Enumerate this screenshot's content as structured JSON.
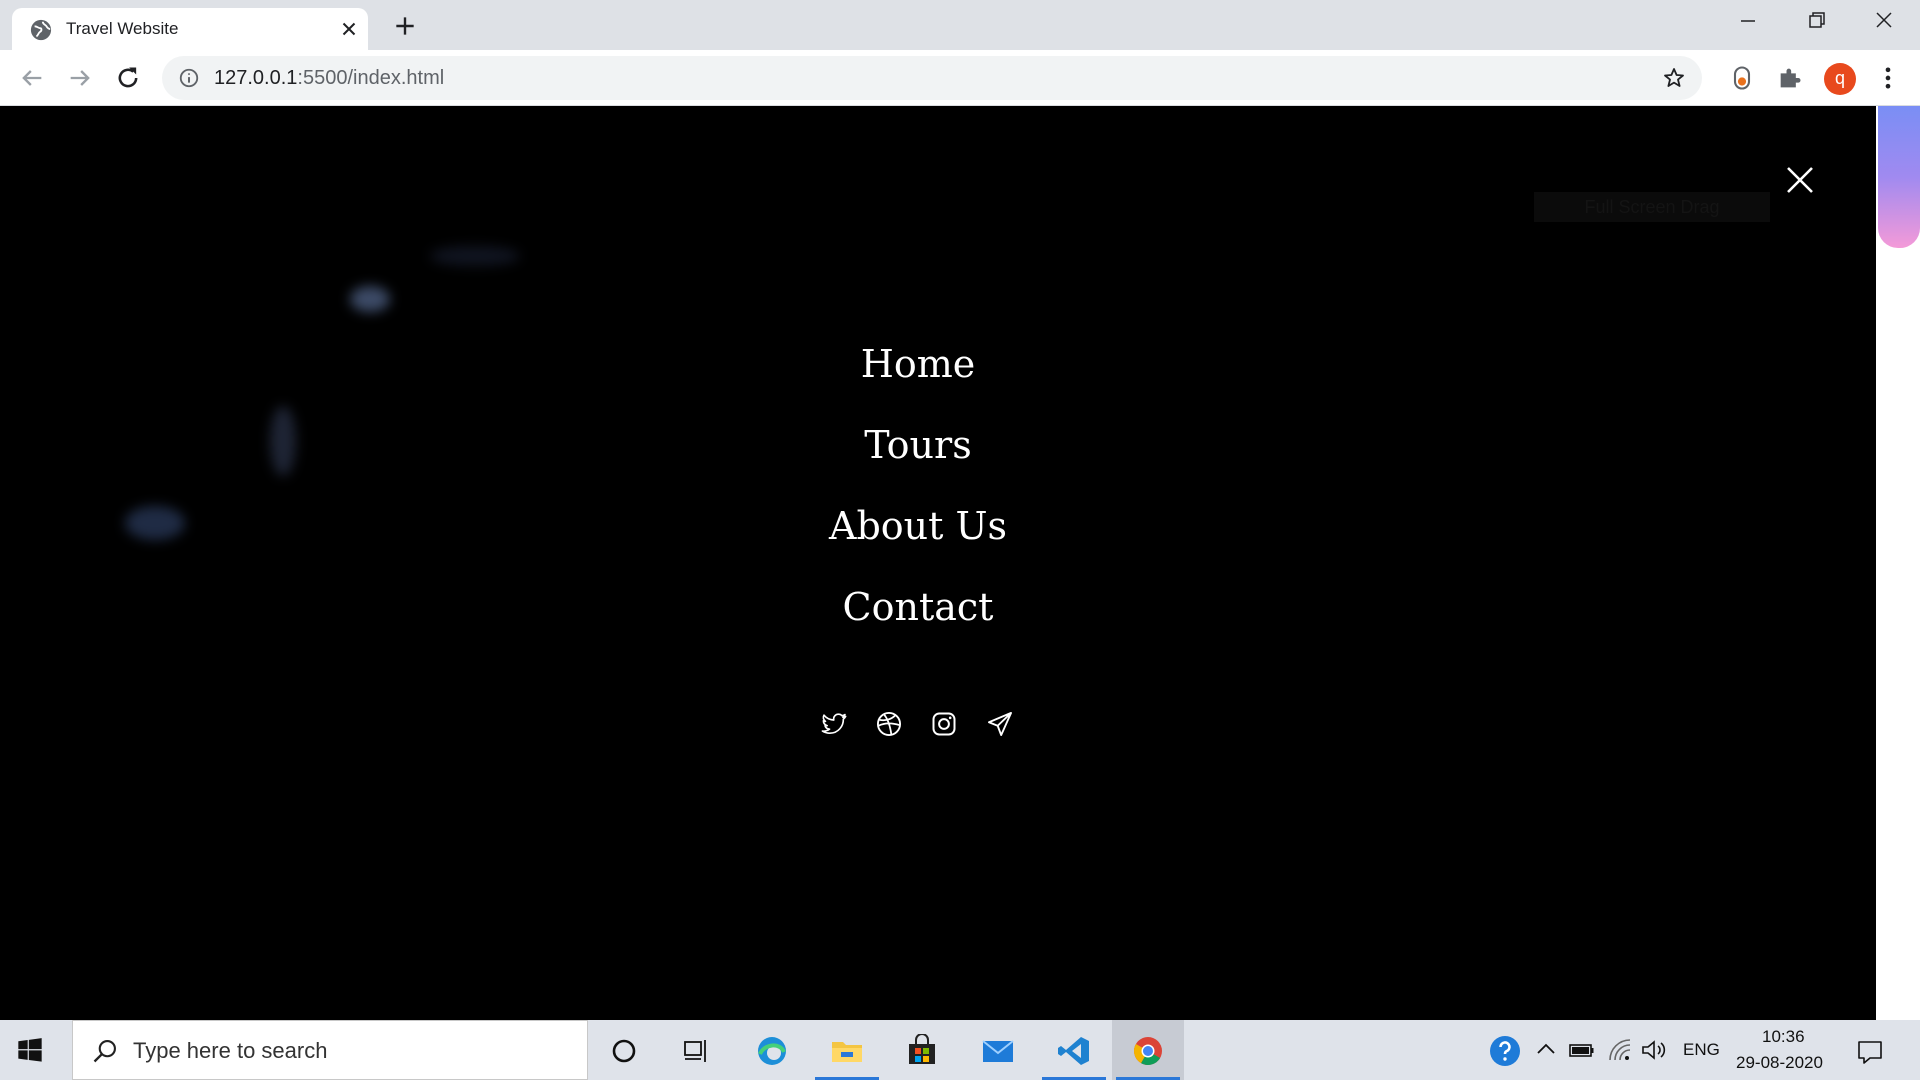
{
  "browser": {
    "tab_title": "Travel Website",
    "url_host": "127.0.0.1",
    "url_rest": ":5500/index.html",
    "avatar_letter": "q"
  },
  "page": {
    "ghost_button_label": "Full Screen Drag",
    "menu": [
      {
        "label": "Home"
      },
      {
        "label": "Tours"
      },
      {
        "label": "About Us"
      },
      {
        "label": "Contact"
      }
    ],
    "socials": [
      "twitter-icon",
      "dribbble-icon",
      "instagram-icon",
      "telegram-icon"
    ],
    "scrollbar_colors": [
      "#7a8ef5",
      "#f49ad8"
    ]
  },
  "taskbar": {
    "search_placeholder": "Type here to search",
    "apps": [
      "cortana-icon",
      "task-view-icon",
      "edge-icon",
      "file-explorer-icon",
      "store-icon",
      "mail-icon",
      "vscode-icon",
      "chrome-icon"
    ],
    "language": "ENG",
    "time": "10:36",
    "date": "29-08-2020"
  }
}
